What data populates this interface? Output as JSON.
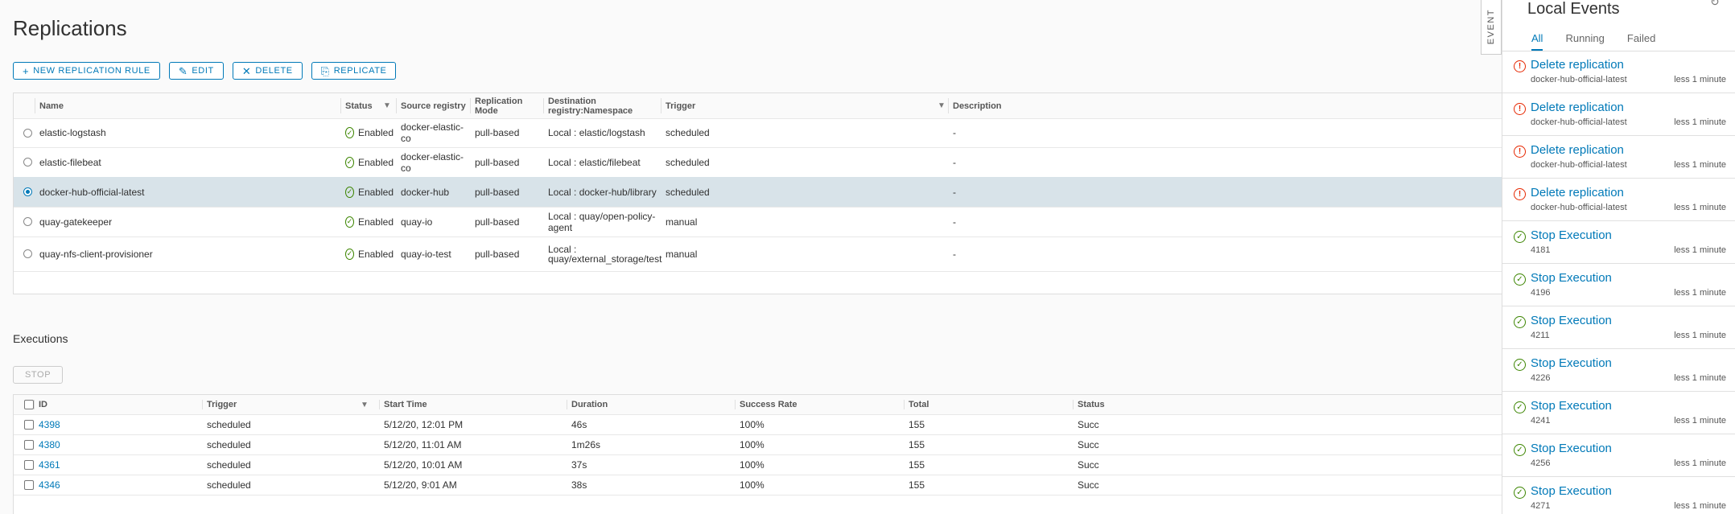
{
  "page": {
    "title": "Replications"
  },
  "toolbar": {
    "new_rule": "NEW REPLICATION RULE",
    "edit": "EDIT",
    "delete": "DELETE",
    "replicate": "REPLICATE"
  },
  "rules": {
    "headers": [
      "Name",
      "Status",
      "Source registry",
      "Replication Mode",
      "Destination registry:Namespace",
      "Trigger",
      "Description"
    ],
    "rows": [
      {
        "name": "elastic-logstash",
        "status": "Enabled",
        "source": "docker-elastic-co",
        "mode": "pull-based",
        "dest": "Local : elastic/logstash",
        "trigger": "scheduled",
        "desc": "-"
      },
      {
        "name": "elastic-filebeat",
        "status": "Enabled",
        "source": "docker-elastic-co",
        "mode": "pull-based",
        "dest": "Local : elastic/filebeat",
        "trigger": "scheduled",
        "desc": "-"
      },
      {
        "name": "docker-hub-official-latest",
        "status": "Enabled",
        "source": "docker-hub",
        "mode": "pull-based",
        "dest": "Local : docker-hub/library",
        "trigger": "scheduled",
        "desc": "-",
        "selected": true
      },
      {
        "name": "quay-gatekeeper",
        "status": "Enabled",
        "source": "quay-io",
        "mode": "pull-based",
        "dest": "Local : quay/open-policy-agent",
        "trigger": "manual",
        "desc": "-"
      },
      {
        "name": "quay-nfs-client-provisioner",
        "status": "Enabled",
        "source": "quay-io-test",
        "mode": "pull-based",
        "dest": "Local : quay/external_storage/test",
        "trigger": "manual",
        "desc": "-"
      }
    ]
  },
  "executions": {
    "title": "Executions",
    "stop": "STOP",
    "headers": [
      "ID",
      "Trigger",
      "Start Time",
      "Duration",
      "Success Rate",
      "Total",
      "Status"
    ],
    "rows": [
      {
        "id": "4398",
        "trigger": "scheduled",
        "start": "5/12/20, 12:01 PM",
        "duration": "46s",
        "rate": "100%",
        "total": "155",
        "status": "Succ"
      },
      {
        "id": "4380",
        "trigger": "scheduled",
        "start": "5/12/20, 11:01 AM",
        "duration": "1m26s",
        "rate": "100%",
        "total": "155",
        "status": "Succ"
      },
      {
        "id": "4361",
        "trigger": "scheduled",
        "start": "5/12/20, 10:01 AM",
        "duration": "37s",
        "rate": "100%",
        "total": "155",
        "status": "Succ"
      },
      {
        "id": "4346",
        "trigger": "scheduled",
        "start": "5/12/20, 9:01 AM",
        "duration": "38s",
        "rate": "100%",
        "total": "155",
        "status": "Succ"
      }
    ]
  },
  "event_tab": "EVENT",
  "events_panel": {
    "title": "Local Events",
    "tabs": [
      "All",
      "Running",
      "Failed"
    ],
    "items": [
      {
        "type": "error",
        "title": "Delete replication",
        "sub": "docker-hub-official-latest",
        "time": "less 1 minute"
      },
      {
        "type": "error",
        "title": "Delete replication",
        "sub": "docker-hub-official-latest",
        "time": "less 1 minute"
      },
      {
        "type": "error",
        "title": "Delete replication",
        "sub": "docker-hub-official-latest",
        "time": "less 1 minute"
      },
      {
        "type": "error",
        "title": "Delete replication",
        "sub": "docker-hub-official-latest",
        "time": "less 1 minute"
      },
      {
        "type": "success",
        "title": "Stop Execution",
        "sub": "4181",
        "time": "less 1 minute"
      },
      {
        "type": "success",
        "title": "Stop Execution",
        "sub": "4196",
        "time": "less 1 minute"
      },
      {
        "type": "success",
        "title": "Stop Execution",
        "sub": "4211",
        "time": "less 1 minute"
      },
      {
        "type": "success",
        "title": "Stop Execution",
        "sub": "4226",
        "time": "less 1 minute"
      },
      {
        "type": "success",
        "title": "Stop Execution",
        "sub": "4241",
        "time": "less 1 minute"
      },
      {
        "type": "success",
        "title": "Stop Execution",
        "sub": "4256",
        "time": "less 1 minute"
      },
      {
        "type": "success",
        "title": "Stop Execution",
        "sub": "4271",
        "time": "less 1 minute"
      }
    ]
  },
  "colors": {
    "accent": "#0079b8",
    "success": "#3c8500",
    "error": "#e62700",
    "selected_row": "#d8e3e9"
  }
}
